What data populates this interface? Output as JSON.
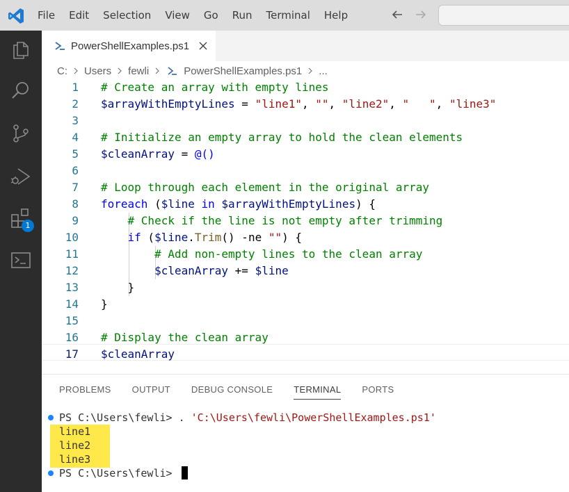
{
  "menu": [
    "File",
    "Edit",
    "Selection",
    "View",
    "Go",
    "Run",
    "Terminal",
    "Help"
  ],
  "activity_badge": "1",
  "tab": {
    "label": "PowerShellExamples.ps1"
  },
  "breadcrumb": {
    "drive": "C:",
    "users": "Users",
    "user": "fewli",
    "file": "PowerShellExamples.ps1",
    "more": "..."
  },
  "editor": {
    "active_line": 17,
    "lines": [
      {
        "num": "1",
        "tokens": [
          [
            "c",
            "# Create an array with empty lines"
          ]
        ]
      },
      {
        "num": "2",
        "tokens": [
          [
            "v",
            "$arrayWithEmptyLines"
          ],
          [
            "o",
            " = "
          ],
          [
            "s",
            "\"line1\""
          ],
          [
            "o",
            ", "
          ],
          [
            "s",
            "\"\""
          ],
          [
            "o",
            ", "
          ],
          [
            "s",
            "\"line2\""
          ],
          [
            "o",
            ", "
          ],
          [
            "s",
            "\"   \""
          ],
          [
            "o",
            ", "
          ],
          [
            "s",
            "\"line3\""
          ]
        ]
      },
      {
        "num": "3",
        "tokens": []
      },
      {
        "num": "4",
        "tokens": [
          [
            "c",
            "# Initialize an empty array to hold the clean elements"
          ]
        ]
      },
      {
        "num": "5",
        "tokens": [
          [
            "v",
            "$cleanArray"
          ],
          [
            "o",
            " = "
          ],
          [
            "k",
            "@()"
          ]
        ]
      },
      {
        "num": "6",
        "tokens": []
      },
      {
        "num": "7",
        "tokens": [
          [
            "c",
            "# Loop through each element in the original array"
          ]
        ]
      },
      {
        "num": "8",
        "tokens": [
          [
            "k",
            "foreach"
          ],
          [
            "o",
            " ("
          ],
          [
            "v",
            "$line"
          ],
          [
            "o",
            " "
          ],
          [
            "k",
            "in"
          ],
          [
            "o",
            " "
          ],
          [
            "v",
            "$arrayWithEmptyLines"
          ],
          [
            "o",
            ") {"
          ]
        ]
      },
      {
        "num": "9",
        "tokens": [
          [
            "o",
            "    "
          ],
          [
            "c",
            "# Check if the line is not empty after trimming"
          ]
        ]
      },
      {
        "num": "10",
        "tokens": [
          [
            "o",
            "    "
          ],
          [
            "k",
            "if"
          ],
          [
            "o",
            " ("
          ],
          [
            "v",
            "$line"
          ],
          [
            "o",
            "."
          ],
          [
            "m",
            "Trim"
          ],
          [
            "o",
            "() -ne "
          ],
          [
            "s",
            "\"\""
          ],
          [
            "o",
            ") {"
          ]
        ]
      },
      {
        "num": "11",
        "tokens": [
          [
            "o",
            "        "
          ],
          [
            "c",
            "# Add non-empty lines to the clean array"
          ]
        ]
      },
      {
        "num": "12",
        "tokens": [
          [
            "o",
            "        "
          ],
          [
            "v",
            "$cleanArray"
          ],
          [
            "o",
            " += "
          ],
          [
            "v",
            "$line"
          ]
        ]
      },
      {
        "num": "13",
        "tokens": [
          [
            "o",
            "    }"
          ]
        ]
      },
      {
        "num": "14",
        "tokens": [
          [
            "o",
            "}"
          ]
        ]
      },
      {
        "num": "15",
        "tokens": []
      },
      {
        "num": "16",
        "tokens": [
          [
            "c",
            "# Display the clean array"
          ]
        ]
      },
      {
        "num": "17",
        "tokens": [
          [
            "v",
            "$cleanArray"
          ]
        ]
      }
    ]
  },
  "panel": {
    "tabs": [
      "PROBLEMS",
      "OUTPUT",
      "DEBUG CONSOLE",
      "TERMINAL",
      "PORTS"
    ],
    "active_tab": "TERMINAL"
  },
  "terminal": {
    "prompt1": "PS C:\\Users\\fewli> ",
    "cmd_op": ". ",
    "cmd_path": "'C:\\Users\\fewli\\PowerShellExamples.ps1'",
    "output": [
      "line1",
      "line2",
      "line3"
    ],
    "prompt2": "PS C:\\Users\\fewli> "
  },
  "colors": {
    "activity_bar": "#2c2c2c",
    "title_bar": "#dddddd",
    "highlight": "#ffe94a",
    "badge": "#0078d4"
  }
}
